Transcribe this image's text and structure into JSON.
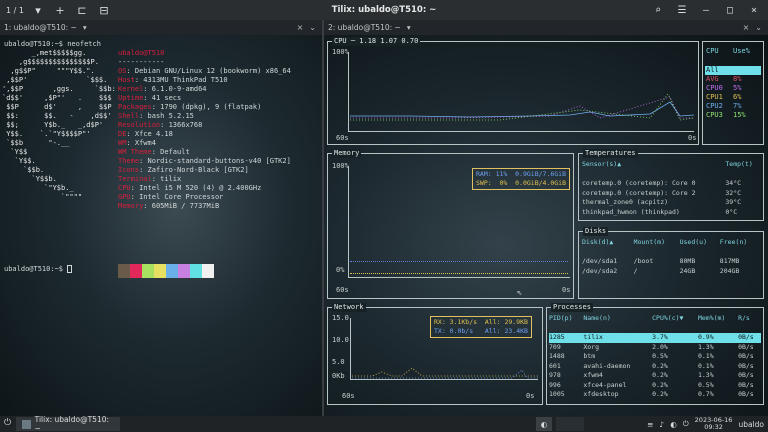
{
  "titlebar": {
    "session": "1 / 1",
    "title": "Tilix: ubaldo@T510: ~",
    "dropdown": "▾",
    "plus": "+",
    "search_icon": "⌕",
    "menu_icon": "☰",
    "minimize": "–",
    "maximize": "□",
    "close": "×"
  },
  "panes": {
    "left_title": "1: ubaldo@T510: ~",
    "right_title": "2: ubaldo@T510: ~",
    "left_icons": [
      "×",
      "⌄"
    ],
    "right_icons": [
      "×",
      "⌄"
    ]
  },
  "left_terminal": {
    "prompt1": "ubaldo@T510:~$ neofetch",
    "prompt2": "ubaldo@T510:~$ ",
    "ascii": [
      "       _,met$$$$$gg.",
      "    ,g$$$$$$$$$$$$$$$P.",
      "  ,g$$P\"     \"\"\"Y$$.\".",
      " ,$$P'              `$$$.",
      "',$$P       ,ggs.     `$$b:",
      "`d$$'     ,$P\"'   .    $$$",
      " $$P      d$'     ,    $$P",
      " $$:      $$.   -    ,d$$'",
      " $$;      Y$b._   _,d$P'",
      " Y$$.    `.`\"Y$$$$P\"'",
      " `$$b      \"-.__",
      "  `Y$$",
      "   `Y$$.",
      "     `$$b.",
      "       `Y$$b.",
      "          `\"Y$b._",
      "              `\"\"\"\""
    ],
    "header": "ubaldo@T510",
    "separator": "-----------",
    "info": [
      {
        "label": "OS",
        "value": "Debian GNU/Linux 12 (bookworm) x86_64"
      },
      {
        "label": "Host",
        "value": "4313MU ThinkPad T510"
      },
      {
        "label": "Kernel",
        "value": "6.1.0-9-amd64"
      },
      {
        "label": "Uptime",
        "value": "41 secs"
      },
      {
        "label": "Packages",
        "value": "1790 (dpkg), 9 (flatpak)"
      },
      {
        "label": "Shell",
        "value": "bash 5.2.15"
      },
      {
        "label": "Resolution",
        "value": "1366x768"
      },
      {
        "label": "DE",
        "value": "Xfce 4.18"
      },
      {
        "label": "WM",
        "value": "Xfwm4"
      },
      {
        "label": "WM Theme",
        "value": "Default"
      },
      {
        "label": "Theme",
        "value": "Nordic-standard-buttons-v40 [GTK2]"
      },
      {
        "label": "Icons",
        "value": "Zafiro-Nord-Black [GTK2]"
      },
      {
        "label": "Terminal",
        "value": "tilix"
      },
      {
        "label": "CPU",
        "value": "Intel i5 M 520 (4) @ 2.400GHz"
      },
      {
        "label": "GPU",
        "value": "Intel Core Processor"
      },
      {
        "label": "Memory",
        "value": "605MiB / 7737MiB"
      }
    ],
    "swatch_colors": [
      "#6a5a4a",
      "#e0285a",
      "#a8e060",
      "#e8e060",
      "#6ab0e8",
      "#c880e0",
      "#60e0e0",
      "#f0f0f0"
    ]
  },
  "btm": {
    "cpu": {
      "title": "CPU ─ 1.18 1.07 0.70",
      "y_top": "100%",
      "x_left": "60s",
      "x_right": "0s",
      "legend_header_cpu": "CPU",
      "legend_header_use": "Use%",
      "legend": [
        {
          "name": "All",
          "use": "",
          "color": "#e0e0e0"
        },
        {
          "name": "AVG",
          "use": "8%",
          "color": "#e0506a"
        },
        {
          "name": "CPU0",
          "use": "5%",
          "color": "#c070f0"
        },
        {
          "name": "CPU1",
          "use": "6%",
          "color": "#e0c050"
        },
        {
          "name": "CPU2",
          "use": "7%",
          "color": "#70b0f0"
        },
        {
          "name": "CPU3",
          "use": "15%",
          "color": "#90e070"
        }
      ]
    },
    "memory": {
      "title": "Memory",
      "y_top": "100%",
      "y_bottom": "0%",
      "x_left": "60s",
      "x_right": "0s",
      "ram_label": "RAM: 11%",
      "ram_value": "0.9GiB/7.6GiB",
      "swp_label": "SWP:  0%",
      "swp_value": "0.0GiB/4.0GiB"
    },
    "temperatures": {
      "title": "Temperatures",
      "col_sensor": "Sensor(s)▲",
      "col_temp": "Temp(t)",
      "rows": [
        {
          "sensor": "coretemp.0 (coretemp): Core 0",
          "temp": "34°C"
        },
        {
          "sensor": "coretemp.0 (coretemp): Core 2",
          "temp": "32°C"
        },
        {
          "sensor": "thermal_zone0 (acpitz)",
          "temp": "39°C"
        },
        {
          "sensor": "thinkpad_hwmon (thinkpad)",
          "temp": "0°C"
        }
      ]
    },
    "disks": {
      "title": "Disks",
      "cols": [
        "Disk(d)▲",
        "Mount(m)",
        "Used(u)",
        "Free(n)"
      ],
      "rows": [
        [
          "/dev/sda1",
          "/boot",
          "80MB",
          "817MB"
        ],
        [
          "/dev/sda2",
          "/",
          "24GB",
          "204GB"
        ]
      ]
    },
    "network": {
      "title": "Network",
      "y_labels": [
        "15.0",
        "10.0",
        "5.0",
        "0Kb"
      ],
      "x_left": "60s",
      "x_right": "0s",
      "rx": "RX: 3.1Kb/s",
      "tx": "TX: 0.0b/s",
      "all_rx": "All: 29.9KB",
      "all_tx": "All: 23.4KB"
    },
    "processes": {
      "title": "Processes",
      "cols": [
        "PID(p)",
        "Name(n)",
        "CPU%(c)▼",
        "Mem%(m)",
        "R/s"
      ],
      "rows": [
        [
          "1285",
          "tilix",
          "3.7%",
          "0.9%",
          "0B/s"
        ],
        [
          "709",
          "Xorg",
          "2.0%",
          "1.3%",
          "0B/s"
        ],
        [
          "1488",
          "btm",
          "0.5%",
          "0.1%",
          "0B/s"
        ],
        [
          "601",
          "avahi-daemon",
          "0.2%",
          "0.1%",
          "0B/s"
        ],
        [
          "978",
          "xfwm4",
          "0.2%",
          "1.3%",
          "0B/s"
        ],
        [
          "996",
          "xfce4-panel",
          "0.2%",
          "0.5%",
          "0B/s"
        ],
        [
          "1005",
          "xfdesktop",
          "0.2%",
          "0.7%",
          "0B/s"
        ]
      ]
    }
  },
  "taskbar": {
    "task_label": "Tilix: ubaldo@T510: ~",
    "date": "2023-06-16",
    "time": "09:32",
    "user": "ubaldo",
    "tray_icons": [
      "≡",
      "♪",
      "◐",
      "⏻"
    ]
  },
  "colors": {
    "accent": "#7fd4e0",
    "label_red": "#d61f3d"
  }
}
